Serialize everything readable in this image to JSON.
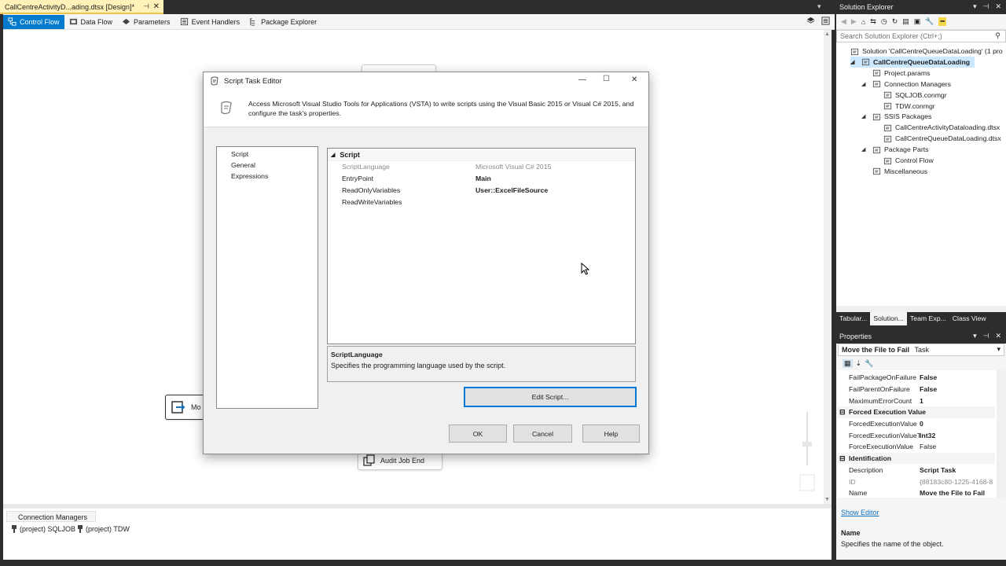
{
  "document_tab": {
    "title": "CallCentreActivityD...ading.dtsx [Design]*",
    "pin": "⊣",
    "close": "✕"
  },
  "designer_tabs": [
    {
      "label": "Control Flow",
      "icon": "control-flow-icon",
      "active": true
    },
    {
      "label": "Data Flow",
      "icon": "data-flow-icon",
      "active": false
    },
    {
      "label": "Parameters",
      "icon": "parameters-icon",
      "active": false
    },
    {
      "label": "Event Handlers",
      "icon": "event-handlers-icon",
      "active": false
    },
    {
      "label": "Package Explorer",
      "icon": "package-explorer-icon",
      "active": false
    }
  ],
  "canvas": {
    "task_partial_label": "Mo",
    "audit_task_label": "Audit Job End"
  },
  "connection_managers": {
    "tab_label": "Connection Managers",
    "items": [
      "(project) SQLJOB",
      "(project) TDW"
    ]
  },
  "dialog": {
    "title": "Script Task Editor",
    "description": "Access Microsoft Visual Studio Tools for Applications (VSTA) to write scripts using the Visual Basic 2015 or Visual C# 2015, and configure the task's properties.",
    "nav_items": [
      "Script",
      "General",
      "Expressions"
    ],
    "category": "Script",
    "properties": [
      {
        "name": "ScriptLanguage",
        "value": "Microsoft Visual C# 2015",
        "dim": true,
        "bold": false
      },
      {
        "name": "EntryPoint",
        "value": "Main",
        "dim": false,
        "bold": true
      },
      {
        "name": "ReadOnlyVariables",
        "value": "User::ExcelFileSource",
        "dim": false,
        "bold": true
      },
      {
        "name": "ReadWriteVariables",
        "value": "",
        "dim": false,
        "bold": false
      }
    ],
    "desc_title": "ScriptLanguage",
    "desc_text": "Specifies the programming language used by the script.",
    "edit_script": "Edit Script...",
    "ok": "OK",
    "cancel": "Cancel",
    "help": "Help"
  },
  "solution_explorer": {
    "title": "Solution Explorer",
    "search_placeholder": "Search Solution Explorer (Ctrl+;)",
    "tree": [
      {
        "label": "Solution 'CallCentreQueueDataLoading' (1 pro",
        "indent": 0,
        "expander": "",
        "icon": "solution-icon",
        "selected": false
      },
      {
        "label": "CallCentreQueueDataLoading",
        "indent": 1,
        "expander": "◢",
        "icon": "project-icon",
        "selected": true
      },
      {
        "label": "Project.params",
        "indent": 2,
        "expander": "",
        "icon": "params-icon",
        "selected": false
      },
      {
        "label": "Connection Managers",
        "indent": 2,
        "expander": "◢",
        "icon": "folder-icon",
        "selected": false
      },
      {
        "label": "SQLJOB.conmgr",
        "indent": 3,
        "expander": "",
        "icon": "conmgr-icon",
        "selected": false
      },
      {
        "label": "TDW.conmgr",
        "indent": 3,
        "expander": "",
        "icon": "conmgr-icon",
        "selected": false
      },
      {
        "label": "SSIS Packages",
        "indent": 2,
        "expander": "◢",
        "icon": "folder-icon",
        "selected": false
      },
      {
        "label": "CallCentreActivityDataloading.dtsx",
        "indent": 3,
        "expander": "",
        "icon": "package-icon",
        "selected": false
      },
      {
        "label": "CallCentreQueueDataLoading.dtsx",
        "indent": 3,
        "expander": "",
        "icon": "package-icon",
        "selected": false
      },
      {
        "label": "Package Parts",
        "indent": 2,
        "expander": "◢",
        "icon": "folder-icon",
        "selected": false
      },
      {
        "label": "Control Flow",
        "indent": 3,
        "expander": "",
        "icon": "folder-icon",
        "selected": false
      },
      {
        "label": "Miscellaneous",
        "indent": 2,
        "expander": "",
        "icon": "folder-icon",
        "selected": false
      }
    ],
    "bottom_tabs": [
      {
        "label": "Tabular...",
        "active": false
      },
      {
        "label": "Solution...",
        "active": true
      },
      {
        "label": "Team Exp...",
        "active": false
      },
      {
        "label": "Class View",
        "active": false
      }
    ]
  },
  "properties_panel": {
    "title": "Properties",
    "object_name": "Move the File to Fail",
    "object_type": "Task",
    "rows": [
      {
        "kind": "prop",
        "name": "FailPackageOnFailure",
        "value": "False",
        "bold": true
      },
      {
        "kind": "prop",
        "name": "FailParentOnFailure",
        "value": "False",
        "bold": true
      },
      {
        "kind": "prop",
        "name": "MaximumErrorCount",
        "value": "1",
        "bold": true
      },
      {
        "kind": "cat",
        "name": "Forced Execution Value"
      },
      {
        "kind": "prop",
        "name": "ForcedExecutionValue",
        "value": "0",
        "bold": true
      },
      {
        "kind": "prop",
        "name": "ForcedExecutionValueType",
        "value": "Int32",
        "bold": true
      },
      {
        "kind": "prop",
        "name": "ForceExecutionValue",
        "value": "False",
        "bold": false
      },
      {
        "kind": "cat",
        "name": "Identification"
      },
      {
        "kind": "prop",
        "name": "Description",
        "value": "Script Task",
        "bold": true
      },
      {
        "kind": "prop",
        "name": "ID",
        "value": "{88183c80-1225-4168-8",
        "bold": false,
        "dim": true
      },
      {
        "kind": "prop",
        "name": "Name",
        "value": "Move the File to Fail",
        "bold": true
      }
    ],
    "show_editor": "Show Editor",
    "desc_title": "Name",
    "desc_text": "Specifies the name of the object."
  },
  "colors": {
    "accent": "#007acc",
    "tab_yellow": "#fff1b8",
    "chrome_dark": "#2d2d30"
  }
}
